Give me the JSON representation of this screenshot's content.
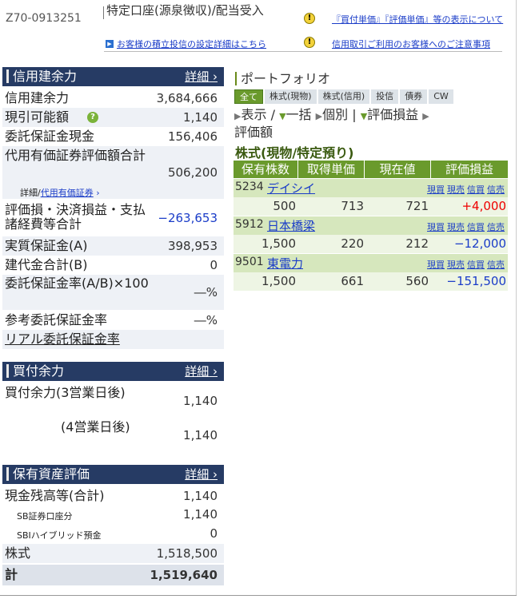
{
  "header": {
    "account_no": "Z70-0913251",
    "account_type": "特定口座(源泉徴収)/配当受入",
    "setting_link": "お客様の積立投信の設定詳細はこちら",
    "note1": "『買付単価』『評価単価』等の表示について",
    "note2": "信用取引ご利用のお客様へのご注意事項",
    "warn_icon": "!",
    "square_icon": "▶"
  },
  "margin": {
    "title": "信用建余力",
    "detail": "詳細",
    "rows": [
      {
        "label": "信用建余力",
        "value": "3,684,666"
      },
      {
        "label": "現引可能額",
        "value": "1,140"
      },
      {
        "label": "委託保証金現金",
        "value": "156,406"
      },
      {
        "label": "代用有価証券評価額合計",
        "value": "506,200"
      },
      {
        "label": "詳細/",
        "link": "代用有価証券"
      },
      {
        "label": "評価損・決済損益・支払諸経費等合計",
        "value": "−263,653"
      },
      {
        "label": "実質保証金(A)",
        "value": "398,953"
      },
      {
        "label": "建代金合計(B)",
        "value": "0"
      },
      {
        "label": "委託保証金率(A/B)×100",
        "value": "―%"
      },
      {
        "label": "参考委託保証金率",
        "value": "―%"
      },
      {
        "label": "リアル委託保証金率"
      }
    ],
    "help_icon": "?"
  },
  "buying": {
    "title": "買付余力",
    "detail": "詳細",
    "rows": [
      {
        "label": "買付余力(3営業日後)",
        "value": "1,140"
      },
      {
        "label": "(4営業日後)",
        "value": "1,140"
      }
    ]
  },
  "assets": {
    "title": "保有資産評価",
    "detail": "詳細",
    "rows": [
      {
        "label": "現金残高等(合計)",
        "value": "1,140"
      },
      {
        "label": "SB証券口座分",
        "value": "1,140"
      },
      {
        "label": "SBIハイブリッド預金",
        "value": "0"
      },
      {
        "label": "株式",
        "value": "1,518,500"
      },
      {
        "label": "計",
        "value": "1,519,640"
      }
    ]
  },
  "portfolio": {
    "title": "ポートフォリオ",
    "tabs": [
      "全て",
      "株式(現物)",
      "株式(信用)",
      "投信",
      "債券",
      "CW"
    ],
    "controls": {
      "display": "表示",
      "slash": "/",
      "bulk": "一括",
      "individual": "個別",
      "sep": "|",
      "eval_pl": "評価損益",
      "eval_amount": "評価額"
    },
    "section_title": "株式(現物/特定預り)",
    "columns": [
      "保有株数",
      "取得単価",
      "現在値",
      "評価損益"
    ],
    "actions": [
      "現買",
      "現売",
      "信買",
      "信売"
    ],
    "holdings": [
      {
        "code": "5234",
        "name": "デイシイ",
        "qty": "500",
        "cost": "713",
        "price": "721",
        "pl": "+4,000",
        "pl_sign": "pos"
      },
      {
        "code": "5912",
        "name": "日本橋梁",
        "qty": "1,500",
        "cost": "220",
        "price": "212",
        "pl": "−12,000",
        "pl_sign": "neg"
      },
      {
        "code": "9501",
        "name": "東電力",
        "qty": "1,500",
        "cost": "661",
        "price": "560",
        "pl": "−151,500",
        "pl_sign": "neg"
      }
    ]
  },
  "colors": {
    "navy": "#263b64",
    "green": "#6a9a2c",
    "link": "#1a3cc8",
    "positive": "#e00000"
  }
}
